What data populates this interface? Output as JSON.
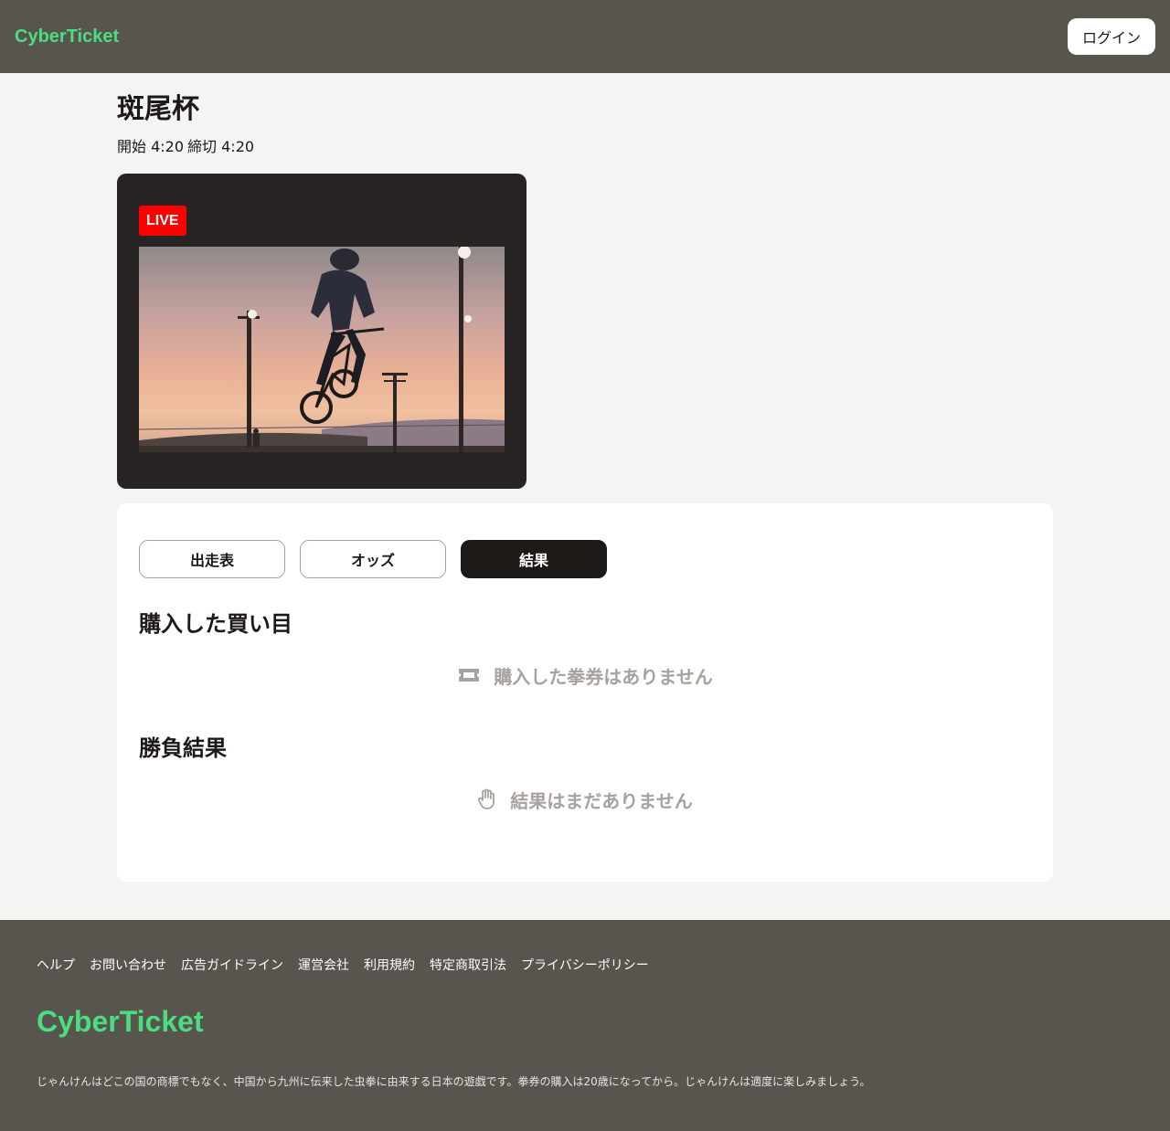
{
  "header": {
    "brand": "CyberTicket",
    "login_label": "ログイン"
  },
  "race": {
    "title": "斑尾杯",
    "start": "開始 4:20",
    "deadline": "締切 4:20",
    "live_label": "LIVE"
  },
  "tabs": [
    {
      "label": "出走表",
      "active": false
    },
    {
      "label": "オッズ",
      "active": false
    },
    {
      "label": "結果",
      "active": true
    }
  ],
  "purchases": {
    "title": "購入した買い目",
    "empty_text": "購入した拳券はありません",
    "icon": "ticket-icon"
  },
  "results": {
    "title": "勝負結果",
    "empty_text": "結果はまだありません",
    "icon": "hand-icon"
  },
  "footer": {
    "links": [
      "ヘルプ",
      "お問い合わせ",
      "広告ガイドライン",
      "運営会社",
      "利用規約",
      "特定商取引法",
      "プライバシーポリシー"
    ],
    "brand": "CyberTicket",
    "disclaimer": "じゃんけんはどこの国の商標でもなく、中国から九州に伝来した虫拳に由来する日本の遊戯です。拳券の購入は20歳になってから。じゃんけんは適度に楽しみましょう。"
  },
  "colors": {
    "brand_green": "#4ade80",
    "header_bg": "#58554f",
    "live_red": "#ff0000",
    "muted": "#a8a29e"
  }
}
